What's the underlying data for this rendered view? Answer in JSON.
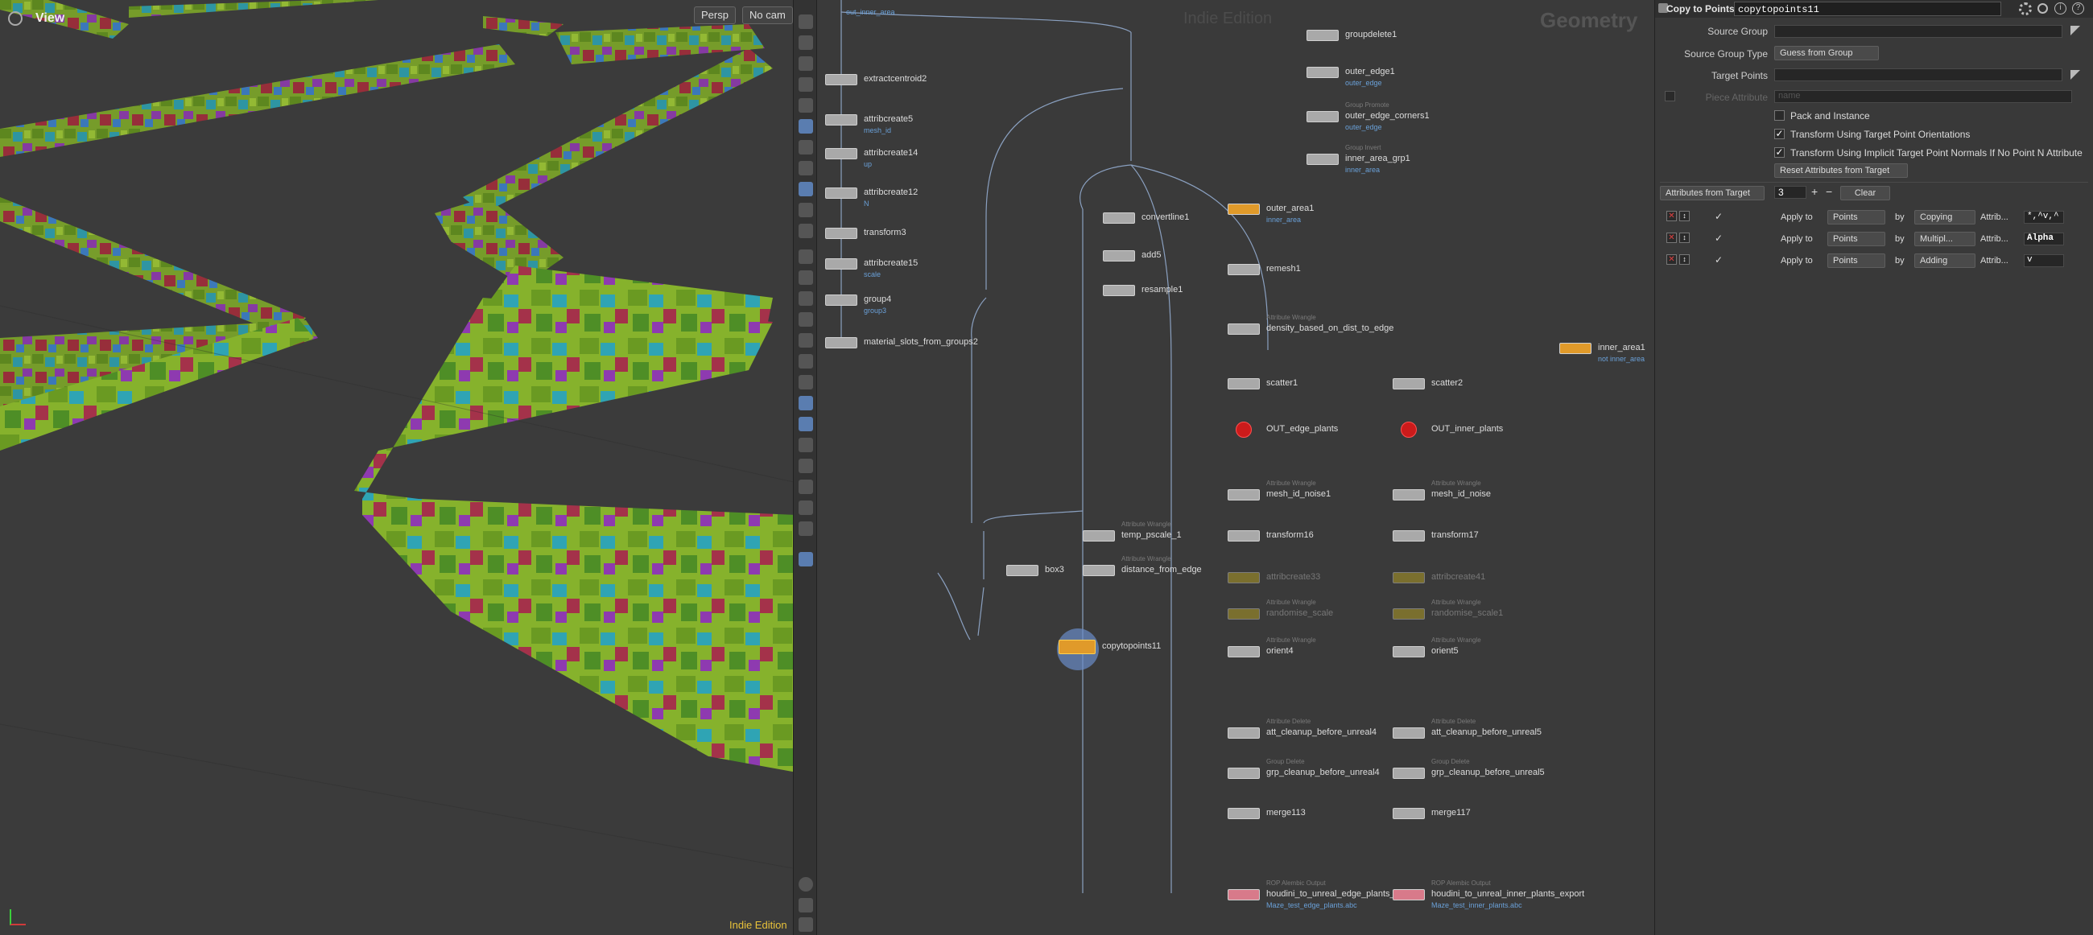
{
  "viewport": {
    "title": "View",
    "persp": "Persp",
    "cam": "No cam",
    "edition": "Indie Edition"
  },
  "network": {
    "watermark": "Indie Edition",
    "context": "Geometry",
    "top_note": "out_inner_area",
    "nodes": [
      {
        "name": "extractcentroid2",
        "sub": "",
        "note": ""
      },
      {
        "name": "attribcreate5",
        "sub": "",
        "note": "mesh_id"
      },
      {
        "name": "attribcreate14",
        "sub": "",
        "note": "up"
      },
      {
        "name": "attribcreate12",
        "sub": "",
        "note": "N"
      },
      {
        "name": "transform3",
        "sub": "",
        "note": ""
      },
      {
        "name": "attribcreate15",
        "sub": "",
        "note": "scale"
      },
      {
        "name": "group4",
        "sub": "",
        "note": "group3"
      },
      {
        "name": "material_slots_from_groups2",
        "sub": "",
        "note": ""
      },
      {
        "name": "groupdelete1",
        "sub": "",
        "note": ""
      },
      {
        "name": "outer_edge1",
        "sub": "",
        "note": "outer_edge"
      },
      {
        "name": "outer_edge_corners1",
        "sub": "Group Promote",
        "note": "outer_edge"
      },
      {
        "name": "inner_area_grp1",
        "sub": "Group Invert",
        "note": "inner_area"
      },
      {
        "name": "convertline1",
        "sub": "",
        "note": ""
      },
      {
        "name": "add5",
        "sub": "",
        "note": ""
      },
      {
        "name": "resample1",
        "sub": "",
        "note": ""
      },
      {
        "name": "outer_area1",
        "sub": "",
        "note": "inner_area"
      },
      {
        "name": "remesh1",
        "sub": "",
        "note": ""
      },
      {
        "name": "density_based_on_dist_to_edge",
        "sub": "Attribute Wrangle",
        "note": ""
      },
      {
        "name": "inner_area1",
        "sub": "",
        "note": "not inner_area"
      },
      {
        "name": "scatter1",
        "sub": "",
        "note": ""
      },
      {
        "name": "scatter2",
        "sub": "",
        "note": ""
      },
      {
        "name": "OUT_edge_plants",
        "sub": "",
        "note": ""
      },
      {
        "name": "OUT_inner_plants",
        "sub": "",
        "note": ""
      },
      {
        "name": "mesh_id_noise1",
        "sub": "Attribute Wrangle",
        "note": ""
      },
      {
        "name": "mesh_id_noise",
        "sub": "Attribute Wrangle",
        "note": ""
      },
      {
        "name": "temp_pscale_1",
        "sub": "Attribute Wrangle",
        "note": ""
      },
      {
        "name": "transform16",
        "sub": "",
        "note": ""
      },
      {
        "name": "transform17",
        "sub": "",
        "note": ""
      },
      {
        "name": "box3",
        "sub": "",
        "note": ""
      },
      {
        "name": "distance_from_edge",
        "sub": "Attribute Wrangle",
        "note": ""
      },
      {
        "name": "attribcreate33",
        "sub": "",
        "note": ""
      },
      {
        "name": "attribcreate41",
        "sub": "",
        "note": ""
      },
      {
        "name": "randomise_scale",
        "sub": "Attribute Wrangle",
        "note": ""
      },
      {
        "name": "randomise_scale1",
        "sub": "Attribute Wrangle",
        "note": ""
      },
      {
        "name": "copytopoints11",
        "sub": "",
        "note": ""
      },
      {
        "name": "orient4",
        "sub": "Attribute Wrangle",
        "note": ""
      },
      {
        "name": "orient5",
        "sub": "Attribute Wrangle",
        "note": ""
      },
      {
        "name": "att_cleanup_before_unreal4",
        "sub": "Attribute Delete",
        "note": ""
      },
      {
        "name": "att_cleanup_before_unreal5",
        "sub": "Attribute Delete",
        "note": ""
      },
      {
        "name": "grp_cleanup_before_unreal4",
        "sub": "Group Delete",
        "note": ""
      },
      {
        "name": "grp_cleanup_before_unreal5",
        "sub": "Group Delete",
        "note": ""
      },
      {
        "name": "merge113",
        "sub": "",
        "note": ""
      },
      {
        "name": "merge117",
        "sub": "",
        "note": ""
      },
      {
        "name": "houdini_to_unreal_edge_plants_export",
        "sub": "ROP Alembic Output",
        "note": "Maze_test_edge_plants.abc"
      },
      {
        "name": "houdini_to_unreal_inner_plants_export",
        "sub": "ROP Alembic Output",
        "note": "Maze_test_inner_plants.abc"
      }
    ]
  },
  "params": {
    "node_type": "Copy to Points",
    "node_name": "copytopoints11",
    "labels": {
      "source_group": "Source Group",
      "source_group_type": "Source Group Type",
      "target_points": "Target Points",
      "piece_attribute": "Piece Attribute"
    },
    "source_group_type_value": "Guess from Group",
    "piece_attribute_placeholder": "name",
    "checks": {
      "pack_and_instance": "Pack and Instance",
      "transform_orient": "Transform Using Target Point Orientations",
      "transform_normals": "Transform Using Implicit Target Point Normals If No Point N Attribute"
    },
    "reset_button": "Reset Attributes from Target",
    "attributes_from_target": "Attributes from Target",
    "attr_count": "3",
    "plus": "+",
    "minus": "−",
    "clear": "Clear",
    "rows": [
      {
        "apply_to": "Apply to",
        "target": "Points",
        "by": "by",
        "mode": "Copying",
        "attrib": "Attrib...",
        "value": "*,^v,^"
      },
      {
        "apply_to": "Apply to",
        "target": "Points",
        "by": "by",
        "mode": "Multipl...",
        "attrib": "Attrib...",
        "value": "Alpha"
      },
      {
        "apply_to": "Apply to",
        "target": "Points",
        "by": "by",
        "mode": "Adding",
        "attrib": "Attrib...",
        "value": "v"
      }
    ]
  },
  "colors": {
    "edition": "#e8c23a",
    "note": "#6aa0d8",
    "out_node": "#cc1b1b",
    "rop": "#d87a8a"
  }
}
